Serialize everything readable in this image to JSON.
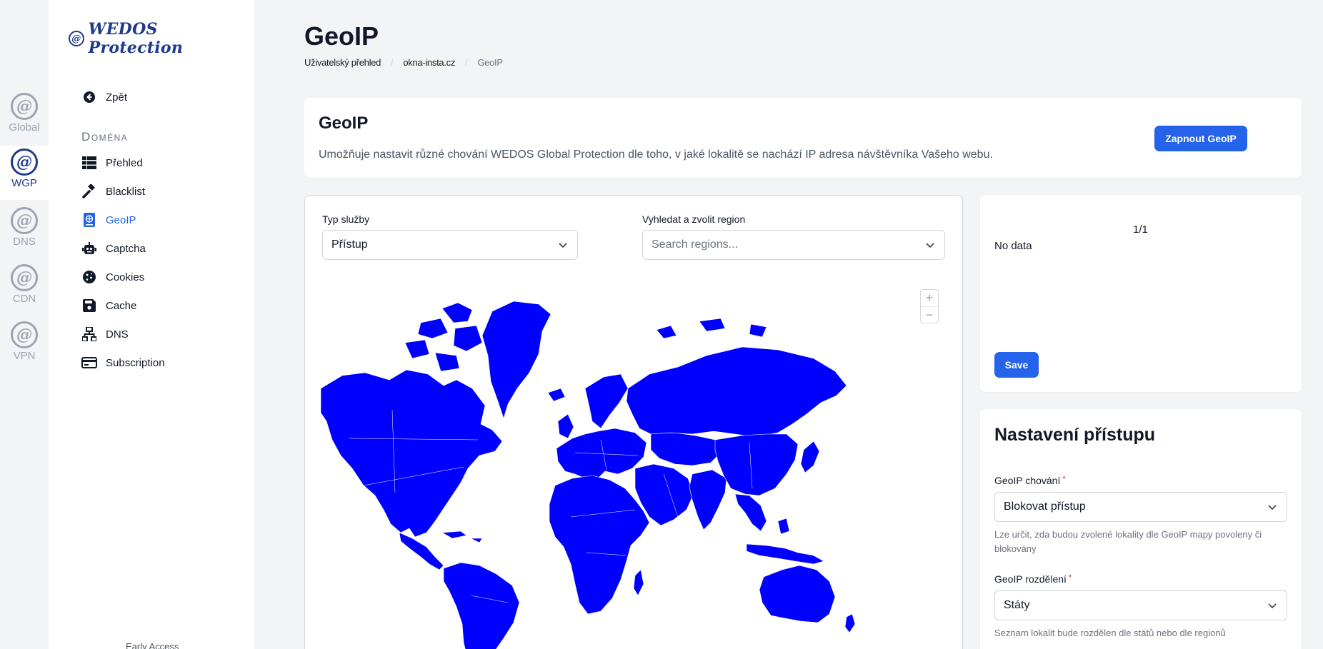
{
  "rail": {
    "items": [
      {
        "label": "Global",
        "glyph": "@"
      },
      {
        "label": "WGP",
        "glyph": "@"
      },
      {
        "label": "DNS",
        "glyph": "@"
      },
      {
        "label": "CDN",
        "glyph": "@"
      },
      {
        "label": "VPN",
        "glyph": "@"
      }
    ],
    "active": "WGP"
  },
  "brand": {
    "mark": "@",
    "name": "WEDOS Protection"
  },
  "sidebar": {
    "back": "Zpět",
    "section": "Doména",
    "items": [
      {
        "label": "Přehled",
        "icon": "table-icon"
      },
      {
        "label": "Blacklist",
        "icon": "gavel-icon"
      },
      {
        "label": "GeoIP",
        "icon": "globe-book-icon"
      },
      {
        "label": "Captcha",
        "icon": "robot-icon"
      },
      {
        "label": "Cookies",
        "icon": "cookie-icon"
      },
      {
        "label": "Cache",
        "icon": "floppy-icon"
      },
      {
        "label": "DNS",
        "icon": "network-icon"
      },
      {
        "label": "Subscription",
        "icon": "credit-card-icon"
      }
    ],
    "active": "GeoIP",
    "footer": "Early Access"
  },
  "page": {
    "title": "GeoIP",
    "breadcrumb": [
      "Uživatelský přehled",
      "okna-insta.cz",
      "GeoIP"
    ]
  },
  "intro": {
    "title": "GeoIP",
    "description": "Umožňuje nastavit různé chování WEDOS Global Protection dle toho, v jaké lokalitě se nachází IP adresa návštěvníka Vašeho webu.",
    "enable_button": "Zapnout GeoIP"
  },
  "filters": {
    "service_label": "Typ služby",
    "service_value": "Přístup",
    "region_label": "Vyhledat a zvolit region",
    "region_placeholder": "Search regions..."
  },
  "map": {
    "zoom_in": "+",
    "zoom_out": "−",
    "fill_color": "#0000ff"
  },
  "selection": {
    "pager": "1/1",
    "empty": "No data",
    "save": "Save"
  },
  "settings": {
    "title": "Nastavení přístupu",
    "behavior_label": "GeoIP chování",
    "behavior_value": "Blokovat přístup",
    "behavior_help": "Lze určit, zda budou zvolené lokality dle GeoIP mapy povoleny či blokovány",
    "split_label": "GeoIP rozdělení",
    "split_value": "Státy",
    "split_help": "Seznam lokalit bude rozdělen dle států nebo dle regionů",
    "required_mark": "*"
  },
  "colors": {
    "accent": "#2563eb",
    "brand": "#1e3a8a",
    "map": "#0000ff"
  }
}
